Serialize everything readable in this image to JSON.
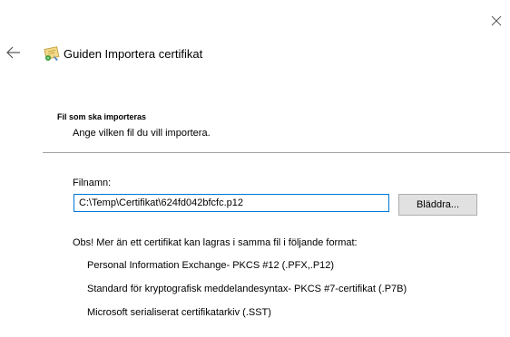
{
  "window": {
    "title": "Guiden Importera certifikat"
  },
  "icons": {
    "close": "close-icon",
    "back": "back-arrow-icon",
    "wizard": "certificate-wizard-icon"
  },
  "section": {
    "title": "Fil som ska importeras",
    "description": "Ange vilken fil du vill importera."
  },
  "file": {
    "label": "Filnamn:",
    "value": "C:\\Temp\\Certifikat\\624fd042bfcfc.p12"
  },
  "browse_label": "Bläddra...",
  "note": "Obs! Mer än ett certifikat kan lagras i samma fil i följande format:",
  "formats": [
    "Personal Information Exchange- PKCS #12 (.PFX,.P12)",
    "Standard för kryptografisk meddelandesyntax- PKCS #7-certifikat (.P7B)",
    "Microsoft serialiserat certifikatarkiv (.SST)"
  ]
}
